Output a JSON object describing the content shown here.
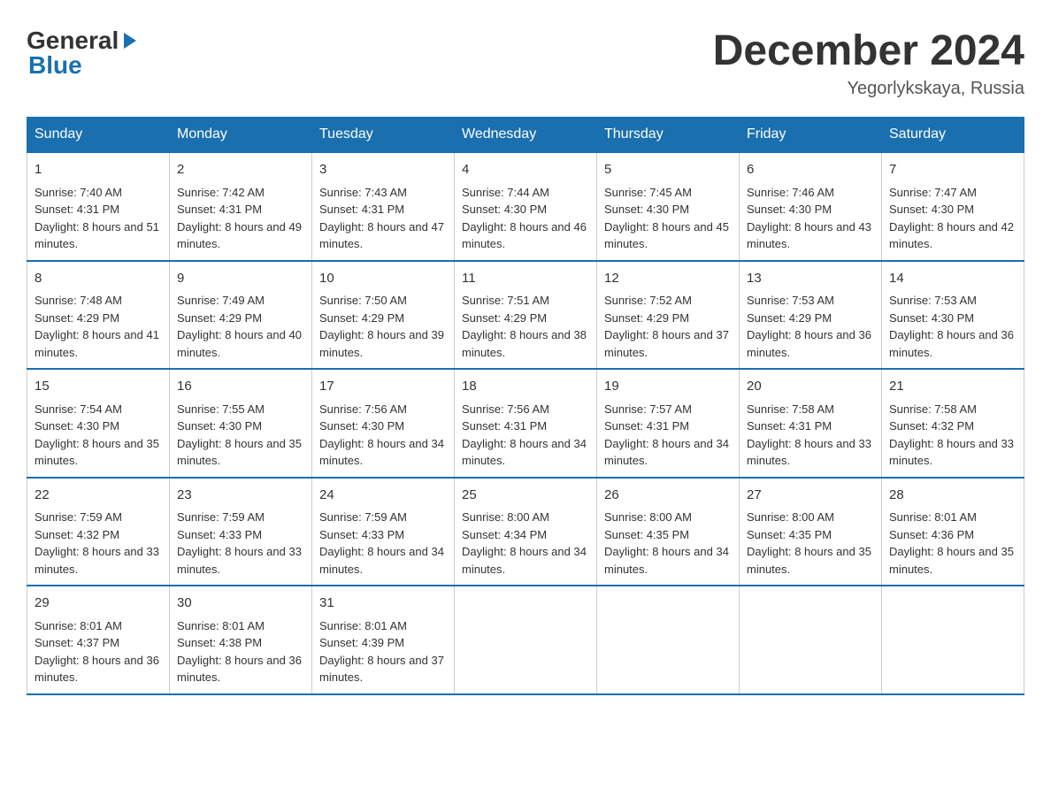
{
  "header": {
    "logo": {
      "general": "General",
      "blue": "Blue",
      "arrow": "▶"
    },
    "title": "December 2024",
    "location": "Yegorlykskaya, Russia"
  },
  "days_of_week": [
    "Sunday",
    "Monday",
    "Tuesday",
    "Wednesday",
    "Thursday",
    "Friday",
    "Saturday"
  ],
  "weeks": [
    [
      {
        "day": "1",
        "sunrise": "7:40 AM",
        "sunset": "4:31 PM",
        "daylight": "8 hours and 51 minutes."
      },
      {
        "day": "2",
        "sunrise": "7:42 AM",
        "sunset": "4:31 PM",
        "daylight": "8 hours and 49 minutes."
      },
      {
        "day": "3",
        "sunrise": "7:43 AM",
        "sunset": "4:31 PM",
        "daylight": "8 hours and 47 minutes."
      },
      {
        "day": "4",
        "sunrise": "7:44 AM",
        "sunset": "4:30 PM",
        "daylight": "8 hours and 46 minutes."
      },
      {
        "day": "5",
        "sunrise": "7:45 AM",
        "sunset": "4:30 PM",
        "daylight": "8 hours and 45 minutes."
      },
      {
        "day": "6",
        "sunrise": "7:46 AM",
        "sunset": "4:30 PM",
        "daylight": "8 hours and 43 minutes."
      },
      {
        "day": "7",
        "sunrise": "7:47 AM",
        "sunset": "4:30 PM",
        "daylight": "8 hours and 42 minutes."
      }
    ],
    [
      {
        "day": "8",
        "sunrise": "7:48 AM",
        "sunset": "4:29 PM",
        "daylight": "8 hours and 41 minutes."
      },
      {
        "day": "9",
        "sunrise": "7:49 AM",
        "sunset": "4:29 PM",
        "daylight": "8 hours and 40 minutes."
      },
      {
        "day": "10",
        "sunrise": "7:50 AM",
        "sunset": "4:29 PM",
        "daylight": "8 hours and 39 minutes."
      },
      {
        "day": "11",
        "sunrise": "7:51 AM",
        "sunset": "4:29 PM",
        "daylight": "8 hours and 38 minutes."
      },
      {
        "day": "12",
        "sunrise": "7:52 AM",
        "sunset": "4:29 PM",
        "daylight": "8 hours and 37 minutes."
      },
      {
        "day": "13",
        "sunrise": "7:53 AM",
        "sunset": "4:29 PM",
        "daylight": "8 hours and 36 minutes."
      },
      {
        "day": "14",
        "sunrise": "7:53 AM",
        "sunset": "4:30 PM",
        "daylight": "8 hours and 36 minutes."
      }
    ],
    [
      {
        "day": "15",
        "sunrise": "7:54 AM",
        "sunset": "4:30 PM",
        "daylight": "8 hours and 35 minutes."
      },
      {
        "day": "16",
        "sunrise": "7:55 AM",
        "sunset": "4:30 PM",
        "daylight": "8 hours and 35 minutes."
      },
      {
        "day": "17",
        "sunrise": "7:56 AM",
        "sunset": "4:30 PM",
        "daylight": "8 hours and 34 minutes."
      },
      {
        "day": "18",
        "sunrise": "7:56 AM",
        "sunset": "4:31 PM",
        "daylight": "8 hours and 34 minutes."
      },
      {
        "day": "19",
        "sunrise": "7:57 AM",
        "sunset": "4:31 PM",
        "daylight": "8 hours and 34 minutes."
      },
      {
        "day": "20",
        "sunrise": "7:58 AM",
        "sunset": "4:31 PM",
        "daylight": "8 hours and 33 minutes."
      },
      {
        "day": "21",
        "sunrise": "7:58 AM",
        "sunset": "4:32 PM",
        "daylight": "8 hours and 33 minutes."
      }
    ],
    [
      {
        "day": "22",
        "sunrise": "7:59 AM",
        "sunset": "4:32 PM",
        "daylight": "8 hours and 33 minutes."
      },
      {
        "day": "23",
        "sunrise": "7:59 AM",
        "sunset": "4:33 PM",
        "daylight": "8 hours and 33 minutes."
      },
      {
        "day": "24",
        "sunrise": "7:59 AM",
        "sunset": "4:33 PM",
        "daylight": "8 hours and 34 minutes."
      },
      {
        "day": "25",
        "sunrise": "8:00 AM",
        "sunset": "4:34 PM",
        "daylight": "8 hours and 34 minutes."
      },
      {
        "day": "26",
        "sunrise": "8:00 AM",
        "sunset": "4:35 PM",
        "daylight": "8 hours and 34 minutes."
      },
      {
        "day": "27",
        "sunrise": "8:00 AM",
        "sunset": "4:35 PM",
        "daylight": "8 hours and 35 minutes."
      },
      {
        "day": "28",
        "sunrise": "8:01 AM",
        "sunset": "4:36 PM",
        "daylight": "8 hours and 35 minutes."
      }
    ],
    [
      {
        "day": "29",
        "sunrise": "8:01 AM",
        "sunset": "4:37 PM",
        "daylight": "8 hours and 36 minutes."
      },
      {
        "day": "30",
        "sunrise": "8:01 AM",
        "sunset": "4:38 PM",
        "daylight": "8 hours and 36 minutes."
      },
      {
        "day": "31",
        "sunrise": "8:01 AM",
        "sunset": "4:39 PM",
        "daylight": "8 hours and 37 minutes."
      },
      null,
      null,
      null,
      null
    ]
  ]
}
